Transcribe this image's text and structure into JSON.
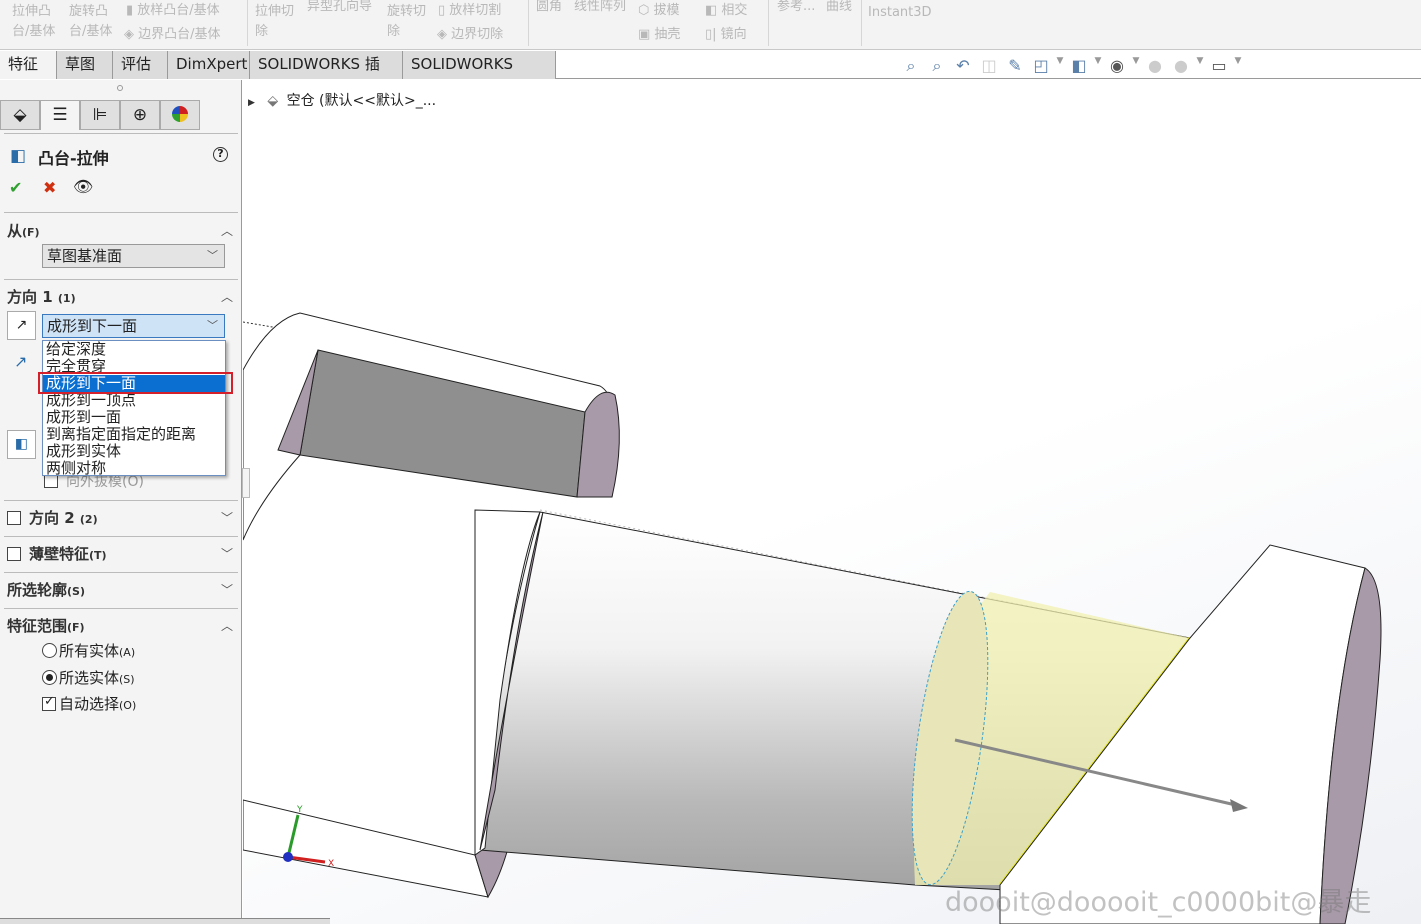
{
  "ribbon": {
    "extrude_boss": "拉伸凸\n台/基体",
    "revolve_boss": "旋转凸\n台/基体",
    "loft_boss": "放样凸台/基体",
    "boundary_boss": "边界凸台/基体",
    "extrude_cut": "拉伸切\n除",
    "hole_wizard": "异型孔向导",
    "revolve_cut": "旋转切\n除",
    "loft_cut": "放样切割",
    "boundary_cut": "边界切除",
    "fillet": "圆角",
    "linear_pattern": "线性阵列",
    "draft": "拔模",
    "intersect": "相交",
    "shell": "抽壳",
    "mirror": "镜向",
    "reference": "参考...",
    "curves": "曲线",
    "instant3d": "Instant3D"
  },
  "tabs": [
    "特征",
    "草图",
    "评估",
    "DimXpert",
    "SOLIDWORKS 插件",
    "SOLIDWORKS MBD"
  ],
  "view_toolbar": [
    "zoom-to-fit-icon",
    "zoom-to-area-icon",
    "previous-view-icon",
    "section-view-icon",
    "dynamic-annotation-icon",
    "view-orientation-icon",
    "display-style-icon",
    "hide-show-icon",
    "edit-appearance-icon",
    "apply-scene-icon",
    "view-settings-icon"
  ],
  "tree": {
    "label": "空仓 (默认<<默认>_..."
  },
  "panel": {
    "title": "凸台-拉伸",
    "help": "?",
    "from": {
      "label": "从",
      "key": "(F)",
      "value": "草图基准面"
    },
    "direction1": {
      "label": "方向 1",
      "key": "(1)",
      "value": "成形到下一面",
      "options": [
        "给定深度",
        "完全贯穿",
        "成形到下一面",
        "成形到一顶点",
        "成形到一面",
        "到离指定面指定的距离",
        "成形到实体",
        "两侧对称"
      ],
      "selected_index": 2,
      "draft_outward": "向外拔模(O)"
    },
    "direction2": {
      "label": "方向 2",
      "key": "(2)",
      "checked": false
    },
    "thin": {
      "label": "薄壁特征",
      "key": "(T)",
      "checked": false
    },
    "contours": {
      "label": "所选轮廓",
      "key": "(S)"
    },
    "scope": {
      "label": "特征范围",
      "key": "(F)",
      "all": {
        "label": "所有实体",
        "key": "(A)",
        "selected": false
      },
      "selected": {
        "label": "所选实体",
        "key": "(S)",
        "selected": true
      },
      "auto": {
        "label": "自动选择",
        "key": "(O)",
        "checked": true
      }
    }
  },
  "triad": {
    "x": "X",
    "y": "Y"
  },
  "watermark": "doooit@dooooit_c0000bit@暴走",
  "colors": {
    "highlight": "#0a6fd0",
    "outline": "#d4202a",
    "face": "#a89aa8",
    "preview": "#f0f0b0"
  }
}
